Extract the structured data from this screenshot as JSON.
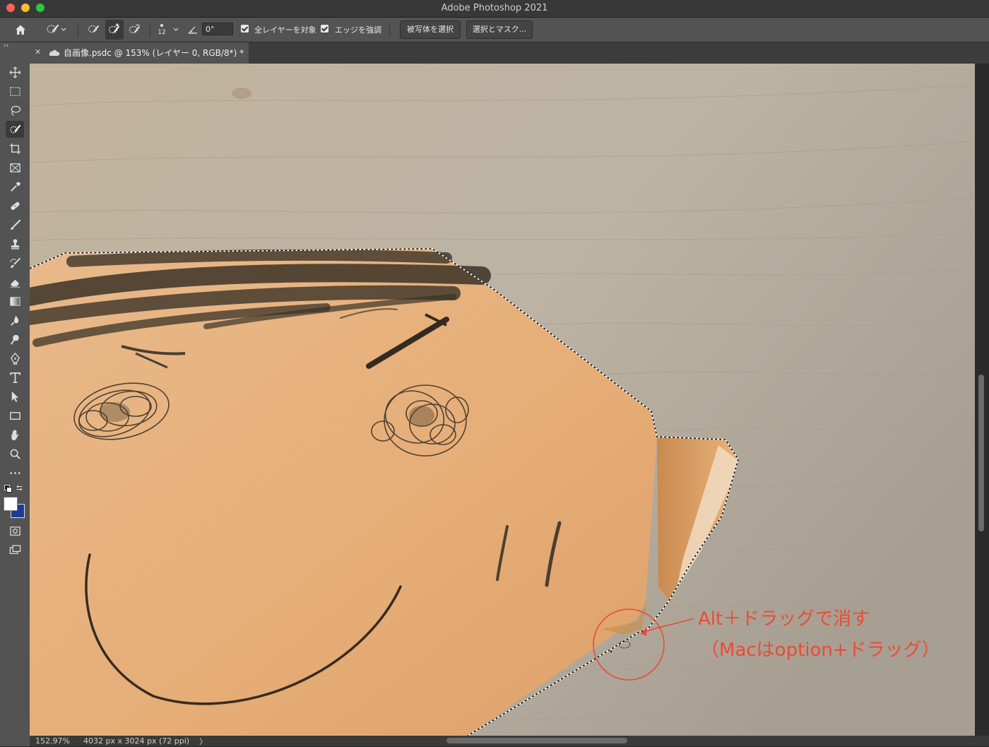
{
  "window": {
    "title": "Adobe Photoshop 2021"
  },
  "options_bar": {
    "brush_size": "12",
    "angle_value": "0°",
    "sample_all_layers_label": "全レイヤーを対象",
    "enhance_edge_label": "エッジを強調",
    "select_subject_label": "被写体を選択",
    "select_and_mask_label": "選択とマスク..."
  },
  "document_tab": {
    "label": "自画像.psdc @ 153% (レイヤー 0, RGB/8*) *"
  },
  "status_bar": {
    "zoom": "152.97%",
    "doc_size": "4032 px x 3024 px (72 ppi)",
    "arrow": "〉"
  },
  "annotation": {
    "line1": "Alt＋ドラッグで消す",
    "line2": "（Macはoption+ドラッグ）",
    "color": "#ea4b38"
  },
  "colors": {
    "foreground": "#ffffff",
    "background": "#1c3a99"
  }
}
